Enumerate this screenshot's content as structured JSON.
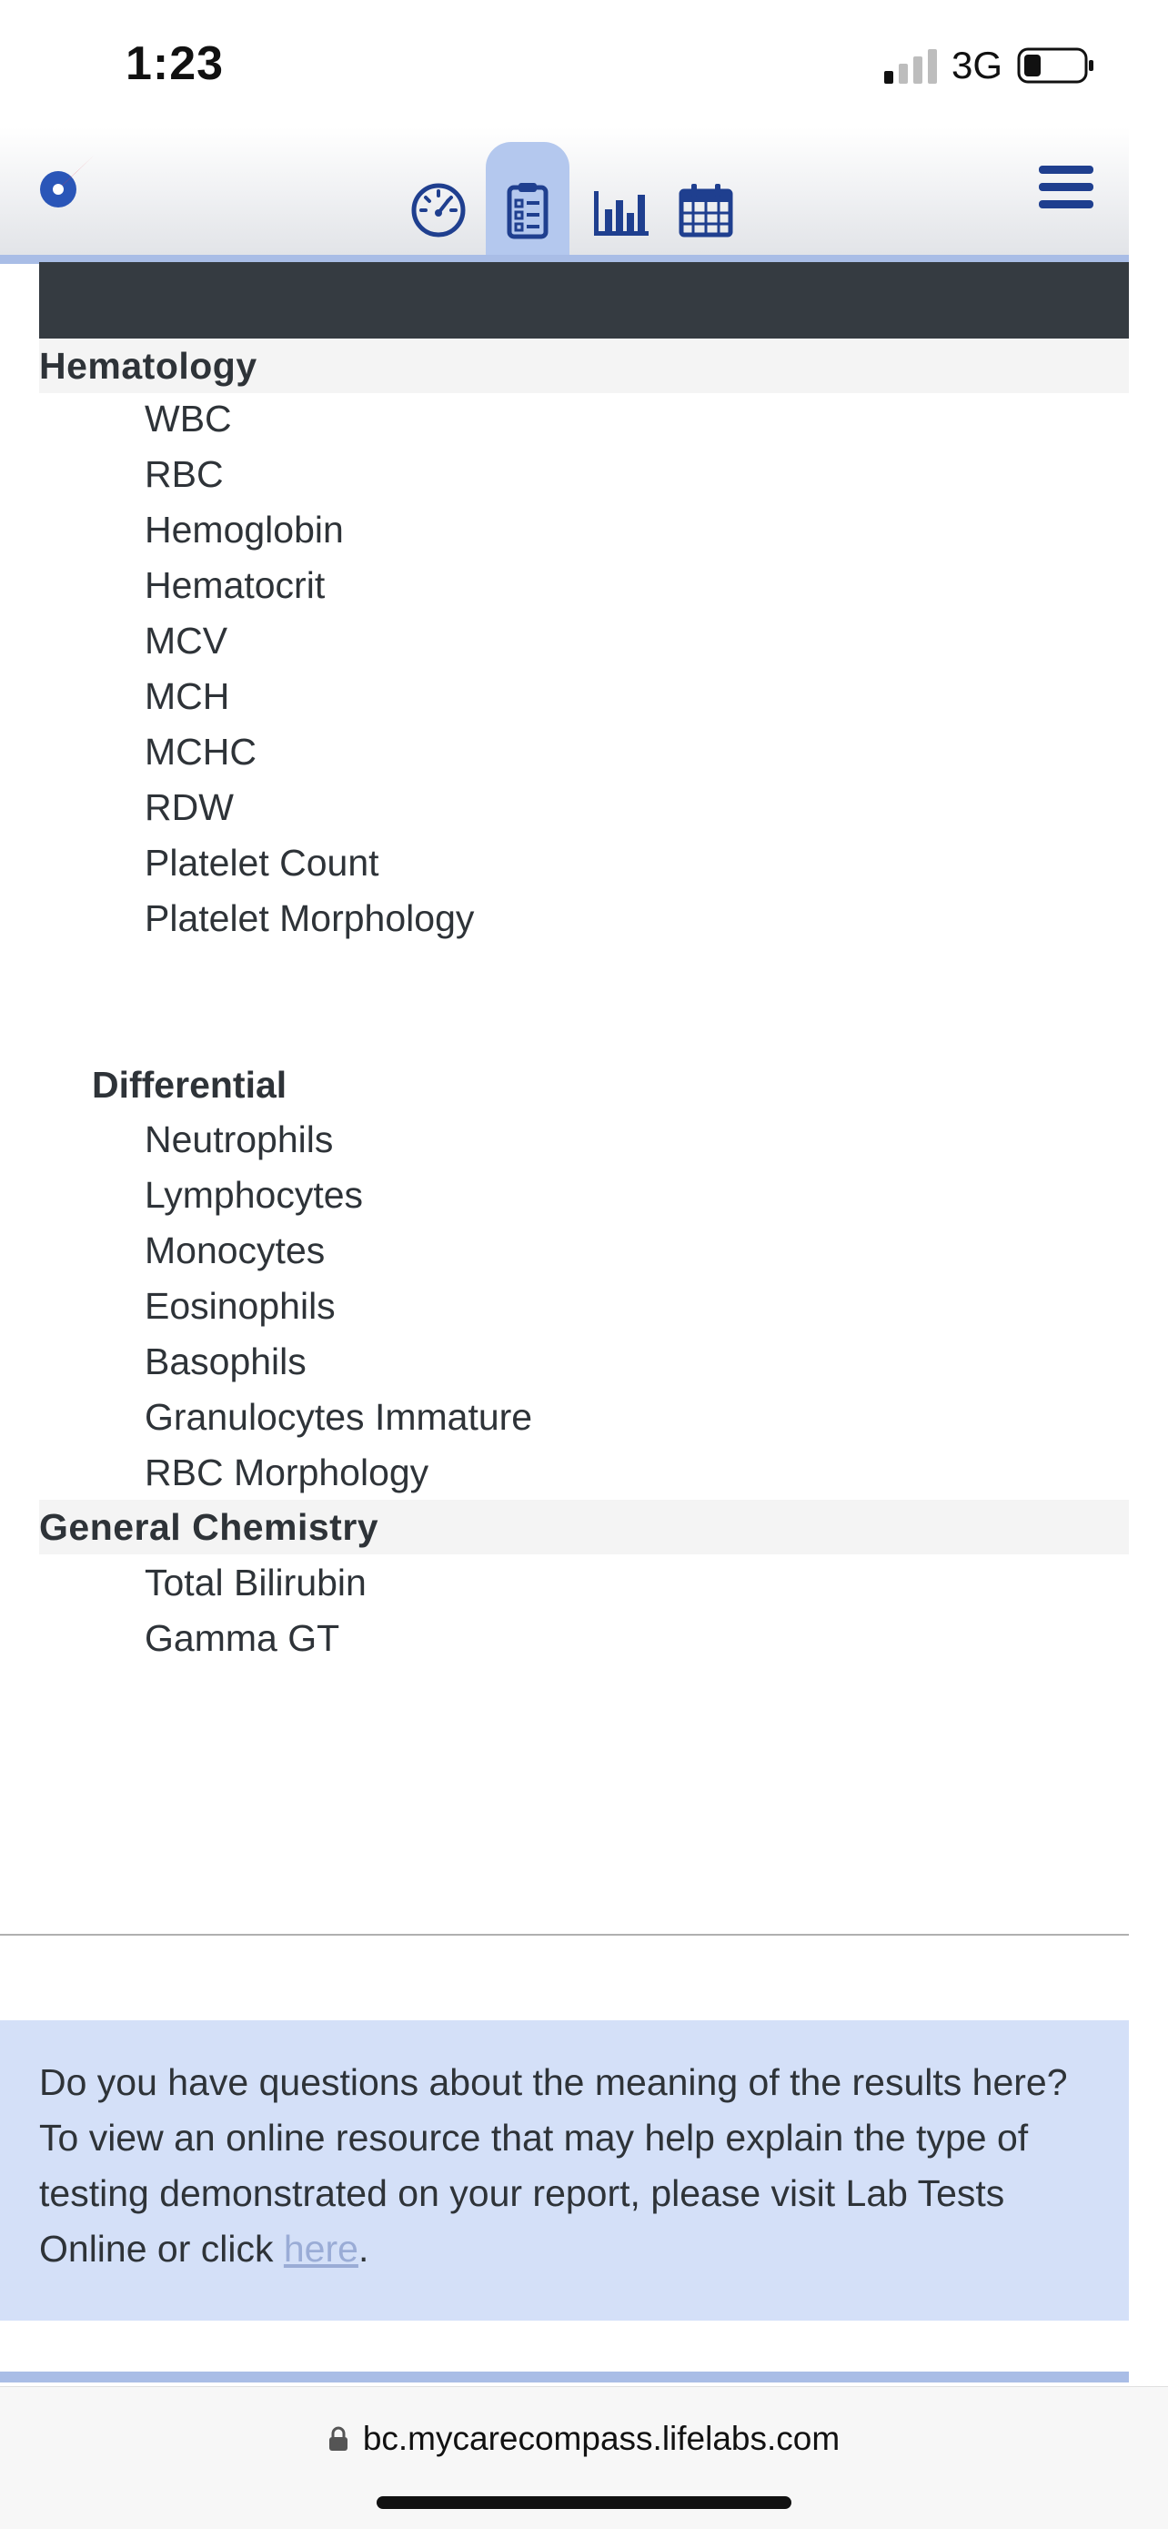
{
  "status_bar": {
    "time": "1:23",
    "network": "3G",
    "icons": [
      "signal-icon",
      "battery-icon"
    ]
  },
  "header": {
    "logo": "compass-logo",
    "tabs": [
      {
        "icon": "dashboard-gauge-icon",
        "active": false
      },
      {
        "icon": "clipboard-report-icon",
        "active": true
      },
      {
        "icon": "bar-chart-icon",
        "active": false
      },
      {
        "icon": "calendar-icon",
        "active": false
      }
    ],
    "menu_icon": "hamburger-menu-icon",
    "accent_color": "#1f3f8f",
    "active_tab_color": "#b4c8ee"
  },
  "report": {
    "sections": [
      {
        "title": "Hematology",
        "tests": [
          "WBC",
          "RBC",
          "Hemoglobin",
          "Hematocrit",
          "MCV",
          "MCH",
          "MCHC",
          "RDW",
          "Platelet Count",
          "Platelet Morphology"
        ],
        "subsection": {
          "title": "Differential",
          "tests": [
            "Neutrophils",
            "Lymphocytes",
            "Monocytes",
            "Eosinophils",
            "Basophils",
            "Granulocytes Immature",
            "RBC Morphology"
          ]
        }
      },
      {
        "title": "General Chemistry",
        "tests": [
          "Total Bilirubin",
          "Gamma GT"
        ]
      }
    ]
  },
  "info": {
    "text": "Do you have questions about the meaning of the results here? To view an online resource that may help explain the type of testing demonstrated on your report, please visit Lab Tests Online or click ",
    "link_text": "here",
    "suffix": "."
  },
  "browser": {
    "url": "bc.mycarecompass.lifelabs.com"
  }
}
